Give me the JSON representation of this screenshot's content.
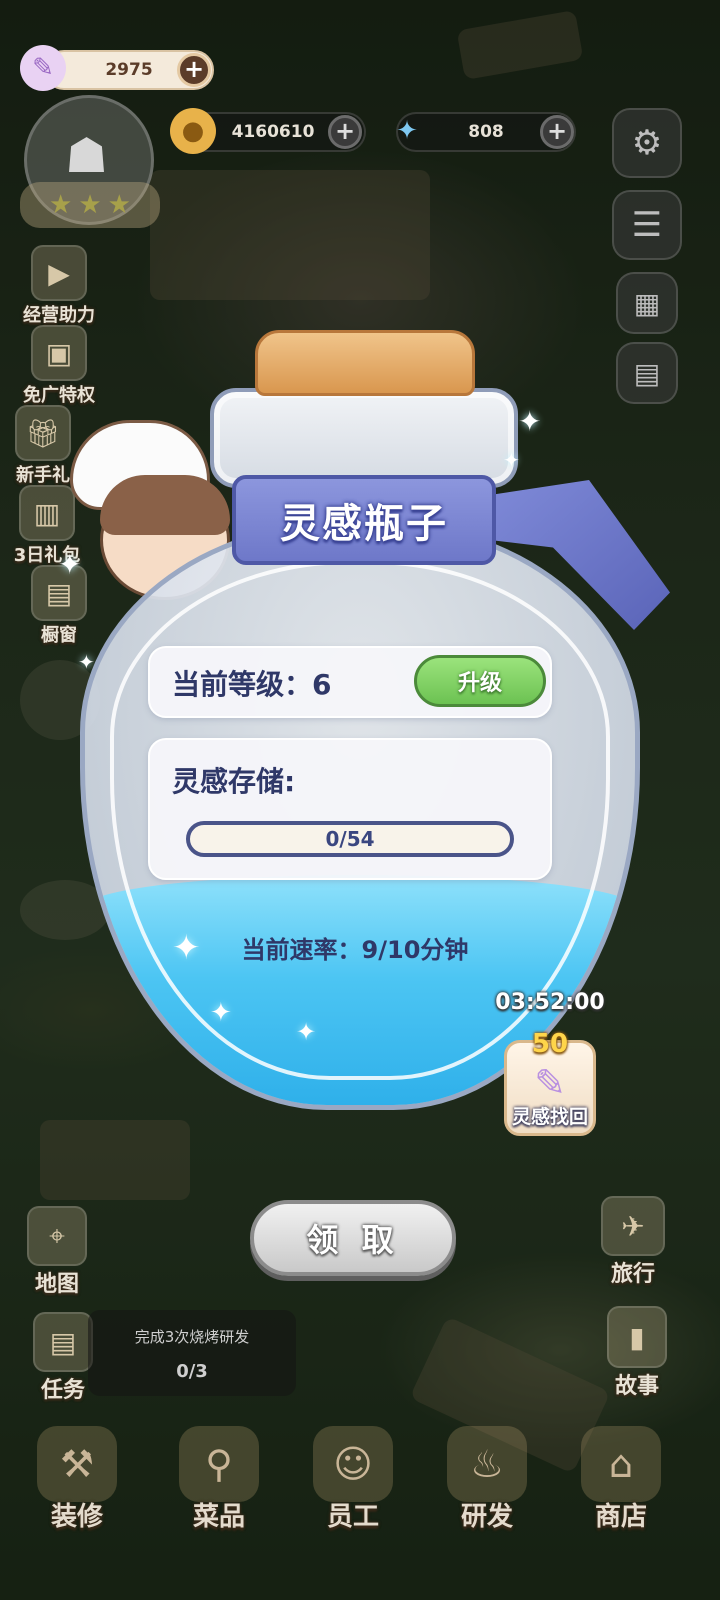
{
  "resources": {
    "feather": {
      "value": "2975",
      "icon": "feather-icon"
    },
    "coins": {
      "value": "4160610",
      "icon": "paw-coin-icon"
    },
    "gems": {
      "value": "808",
      "icon": "star-gem-icon"
    }
  },
  "left_menu": [
    {
      "label": "经营助力",
      "icon": "boost-icon"
    },
    {
      "label": "免广特权",
      "icon": "ad-free-icon"
    },
    {
      "label": "新手礼",
      "icon": "gift-icon"
    },
    {
      "label": "3日礼包",
      "icon": "pack-icon"
    },
    {
      "label": "橱窗",
      "icon": "showcase-icon"
    }
  ],
  "popup": {
    "title": "灵感瓶子",
    "level_label": "当前等级：6",
    "upgrade_label": "升级",
    "storage_label": "灵感存储:",
    "storage_progress": "0/54",
    "storage_fraction": 0,
    "rate_label": "当前速率：9/10分钟",
    "timer": "03:52:00",
    "recover_count": "50",
    "recover_label": "灵感找回",
    "claim_label": "领 取"
  },
  "left_bottom": [
    {
      "label": "地图",
      "icon": "map-icon"
    },
    {
      "label": "任务",
      "icon": "clipboard-icon"
    }
  ],
  "right_bottom": [
    {
      "label": "旅行",
      "icon": "plane-icon"
    },
    {
      "label": "故事",
      "icon": "book-icon"
    }
  ],
  "task": {
    "title": "完成3次烧烤研发",
    "progress": "0/3"
  },
  "bottom_nav": [
    {
      "label": "装修",
      "icon": "decor-icon"
    },
    {
      "label": "菜品",
      "icon": "dishes-icon"
    },
    {
      "label": "员工",
      "icon": "staff-icon"
    },
    {
      "label": "研发",
      "icon": "research-icon"
    },
    {
      "label": "商店",
      "icon": "shop-icon"
    }
  ],
  "colors": {
    "accent_green": "#6cc252",
    "ribbon": "#6e78c9",
    "water": "#4cc5f3"
  }
}
